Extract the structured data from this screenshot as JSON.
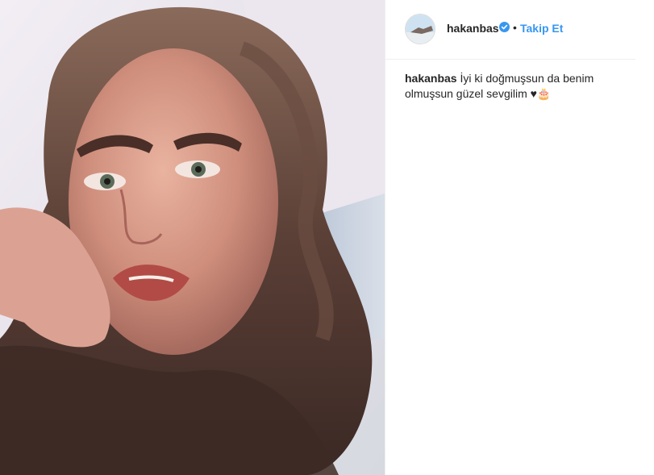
{
  "post": {
    "image_description_icon": "portrait-photo"
  },
  "header": {
    "username": "hakanbas",
    "separator": "•",
    "follow_label": "Takip Et",
    "verified_color": "#3897f0"
  },
  "caption": {
    "username": "hakanbas",
    "text": "İyi ki doğmuşsun da benim olmuşsun güzel sevgilim ♥🎂"
  }
}
